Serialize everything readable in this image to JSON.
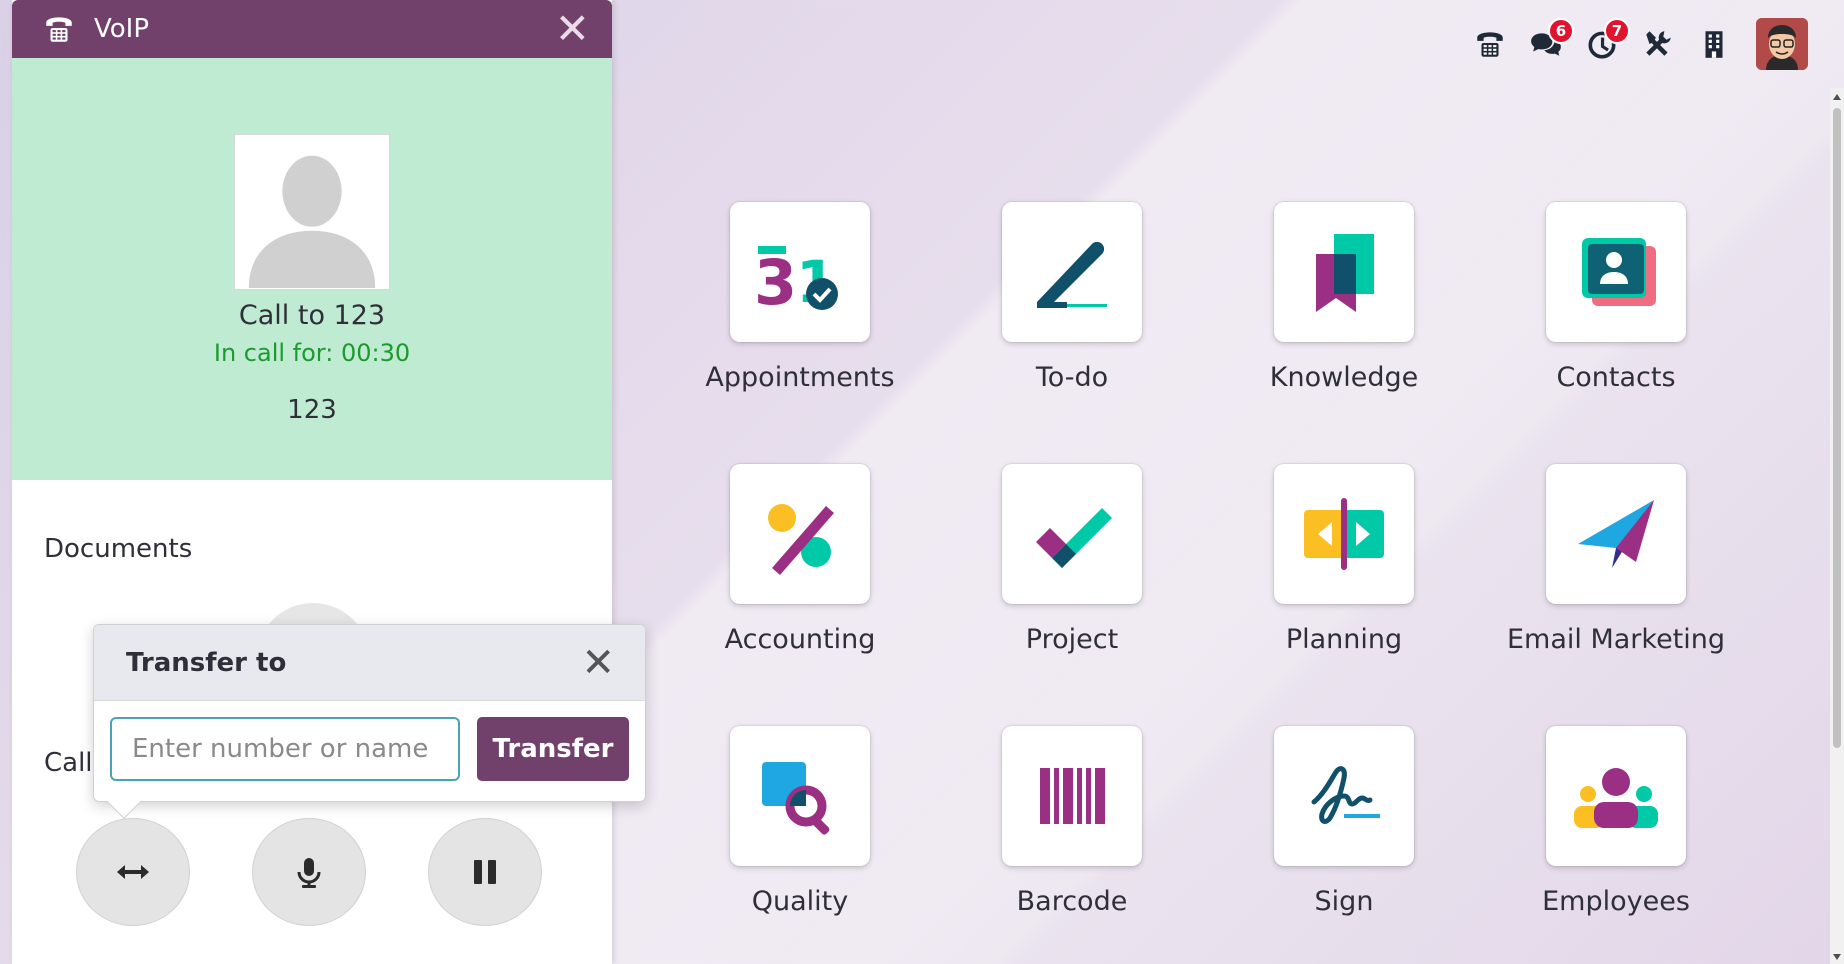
{
  "voip": {
    "title": "VoIP",
    "call_to": "Call to 123",
    "in_call": "In call for: 00:30",
    "number": "123",
    "documents_label": "Documents",
    "call_label": "Call",
    "header_color": "#71406b",
    "call_bg_color": "#bfebd2"
  },
  "transfer": {
    "title": "Transfer to",
    "placeholder": "Enter number or name",
    "value": "",
    "button_label": "Transfer"
  },
  "systray": {
    "messages_count": "6",
    "activities_count": "7",
    "icons": [
      "phone-icon",
      "chat-icon",
      "clock-icon",
      "tools-icon",
      "building-icon"
    ]
  },
  "apps": [
    {
      "label": "Appointments",
      "icon": "appointments-icon"
    },
    {
      "label": "To-do",
      "icon": "todo-icon"
    },
    {
      "label": "Knowledge",
      "icon": "knowledge-icon"
    },
    {
      "label": "Contacts",
      "icon": "contacts-icon"
    },
    {
      "label": "Accounting",
      "icon": "accounting-icon"
    },
    {
      "label": "Project",
      "icon": "project-icon"
    },
    {
      "label": "Planning",
      "icon": "planning-icon"
    },
    {
      "label": "Email Marketing",
      "icon": "email-marketing-icon"
    },
    {
      "label": "Quality",
      "icon": "quality-icon"
    },
    {
      "label": "Barcode",
      "icon": "barcode-icon"
    },
    {
      "label": "Sign",
      "icon": "sign-icon"
    },
    {
      "label": "Employees",
      "icon": "employees-icon"
    }
  ]
}
